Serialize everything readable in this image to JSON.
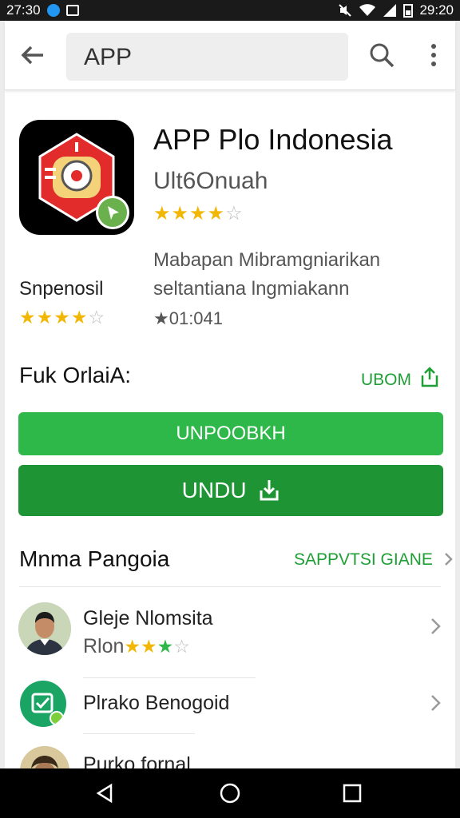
{
  "status_bar": {
    "time_left": "27:30",
    "time_right": "29:20"
  },
  "search": {
    "query": "APP"
  },
  "app": {
    "title": "APP Plo Indonesia",
    "developer": "Ult6Onuah",
    "rating_stars": 4,
    "description_line1": "Mabapan Mibramgniarikan",
    "description_line2": "seltantiana lngmiakann",
    "review_count": "★01:041",
    "secondary_label": "Snpenosil",
    "secondary_stars": 4
  },
  "section1": {
    "heading": "Fuk OrlaiA:",
    "link": "UBOM"
  },
  "buttons": {
    "primary": "UNPOOBKH",
    "install": "UNDU"
  },
  "section2": {
    "heading": "Mnma Pangoia",
    "link": "SAPPVTSI GIANE"
  },
  "list": [
    {
      "title": "Gleje Nlomsita",
      "subtitle": "Rlon",
      "stars": 3
    },
    {
      "title": "Plrako Benogoid"
    },
    {
      "title": "Purko fornal"
    }
  ],
  "colors": {
    "accent_green": "#2eb84a",
    "dark_green": "#1f9435",
    "link_green": "#1e9e35",
    "star": "#f2b705"
  }
}
